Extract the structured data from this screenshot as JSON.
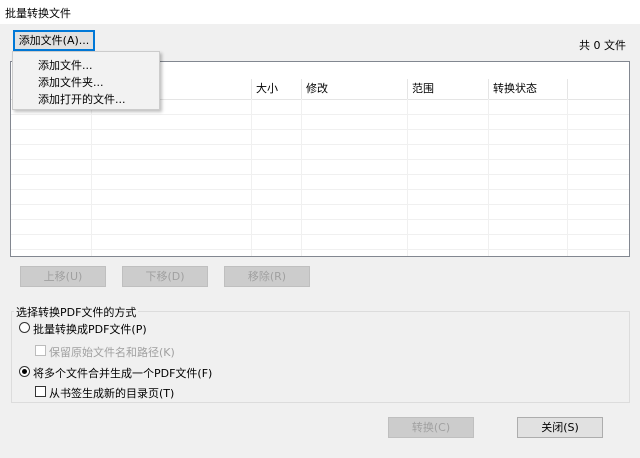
{
  "window": {
    "title": "批量转换文件"
  },
  "toolbar": {
    "add_files_label": "添加文件(A)..."
  },
  "file_count": "共 0 文件",
  "dropdown": {
    "items": [
      "添加文件...",
      "添加文件夹...",
      "添加打开的文件..."
    ]
  },
  "table": {
    "columns": [
      "",
      "",
      "大小",
      "修改",
      "范围",
      "转换状态",
      ""
    ],
    "rows": []
  },
  "list_buttons": {
    "up": "上移(U)",
    "down": "下移(D)",
    "remove": "移除(R)"
  },
  "options": {
    "legend": "选择转换PDF文件的方式",
    "batch_label": "批量转换成PDF文件(P)",
    "keep_name_label": "保留原始文件名和路径(K)",
    "merge_label": "将多个文件合并生成一个PDF文件(F)",
    "toc_label": "从书签生成新的目录页(T)",
    "selected": "merge"
  },
  "footer": {
    "convert": "转换(C)",
    "close": "关闭(S)"
  }
}
